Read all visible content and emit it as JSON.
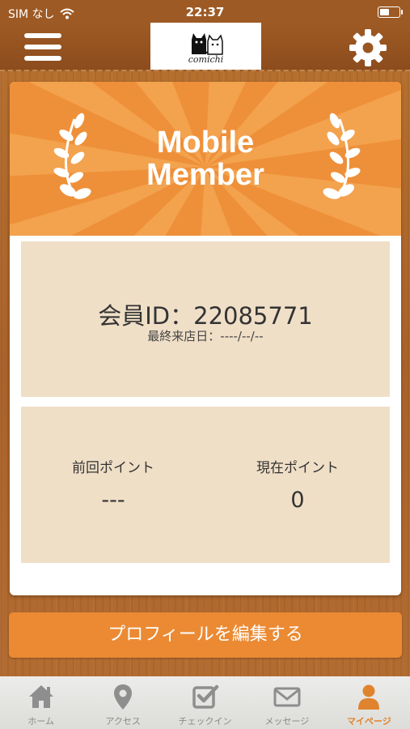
{
  "status_bar": {
    "carrier": "SIM なし",
    "time": "22:37"
  },
  "header": {
    "logo_text": "comichi"
  },
  "card": {
    "title_line1": "Mobile",
    "title_line2": "Member",
    "member_id": "会員ID：22085771",
    "last_visit": "最終来店日：----/--/--",
    "previous_points_label": "前回ポイント",
    "previous_points_value": "---",
    "current_points_label": "現在ポイント",
    "current_points_value": "0"
  },
  "edit_profile_button": "プロフィールを編集する",
  "tabs": [
    {
      "label": "ホーム",
      "icon": "home-icon",
      "active": false
    },
    {
      "label": "アクセス",
      "icon": "location-pin-icon",
      "active": false
    },
    {
      "label": "チェックイン",
      "icon": "checkbox-icon",
      "active": false
    },
    {
      "label": "メッセージ",
      "icon": "envelope-icon",
      "active": false
    },
    {
      "label": "マイページ",
      "icon": "person-icon",
      "active": true
    }
  ],
  "colors": {
    "accent": "#eb8a33",
    "panel": "#f0dfc7",
    "tab_inactive": "#8a8a8a"
  }
}
